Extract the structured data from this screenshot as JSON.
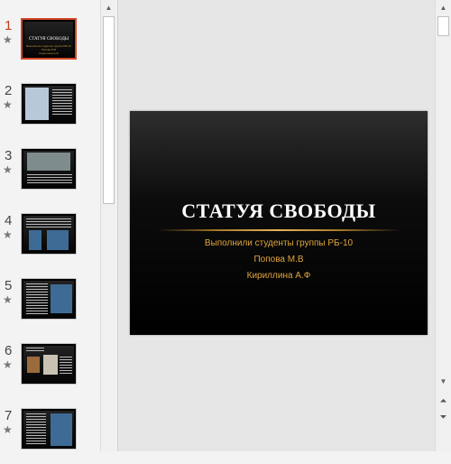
{
  "slide": {
    "title": "СТАТУЯ СВОБОДЫ",
    "subtitle_lines": [
      "Выполнили студенты группы РБ-10",
      "Попова М.В",
      "Кириллина А.Ф"
    ]
  },
  "thumbnails": [
    {
      "number": "1",
      "active": true
    },
    {
      "number": "2",
      "active": false
    },
    {
      "number": "3",
      "active": false
    },
    {
      "number": "4",
      "active": false
    },
    {
      "number": "5",
      "active": false
    },
    {
      "number": "6",
      "active": false
    },
    {
      "number": "7",
      "active": false
    }
  ],
  "thumb_star": "★",
  "thumbnail_1": {
    "title": "СТАТУЯ СВОБОДЫ",
    "lines": [
      "Выполнили студенты группы РБ-10",
      "Попова М.В",
      "Кириллина А.Ф"
    ]
  },
  "icons": {
    "star": "star-icon",
    "scroll_up": "scroll-up-arrow-icon",
    "scroll_down": "scroll-down-arrow-icon",
    "prev_slide": "previous-slide-icon",
    "next_slide": "next-slide-icon"
  },
  "glyphs": {
    "up": "▲",
    "down": "▼",
    "prev": "⏶",
    "next": "⏷"
  },
  "colors": {
    "active_border": "#d24726",
    "active_number": "#c43e1c",
    "subtitle": "#e0a63c"
  }
}
